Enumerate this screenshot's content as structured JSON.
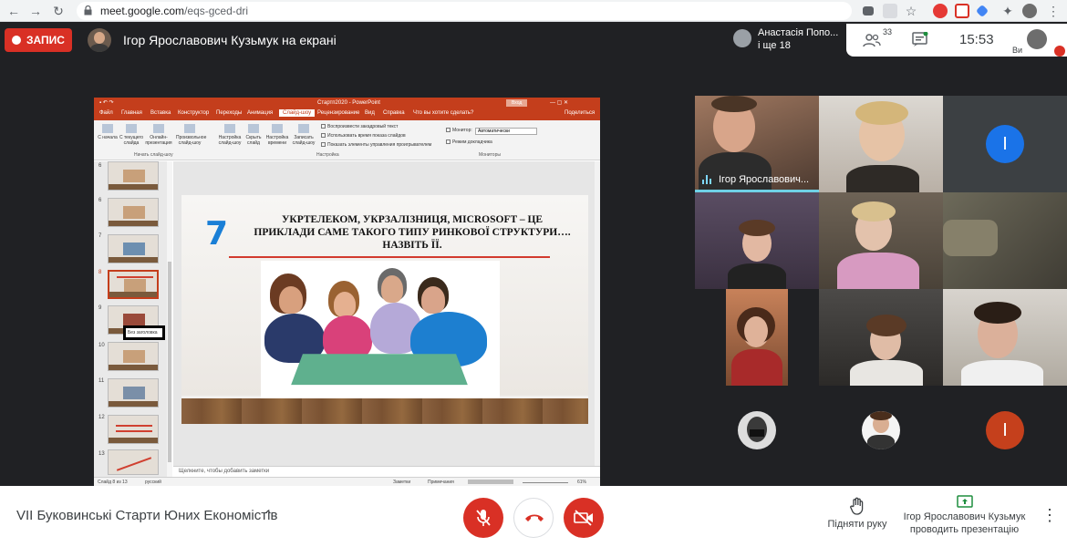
{
  "browser": {
    "url_host": "meet.google.com",
    "url_path": "/eqs-gced-dri"
  },
  "recording": {
    "label": "ЗАПИС"
  },
  "presentation": {
    "title": "Ігор Ярославович Кузьмук на екрані"
  },
  "notification": {
    "line1": "Анастасія Попо...",
    "line2": "і ще 18"
  },
  "status": {
    "participants_count": "33",
    "time": "15:53",
    "me_label": "Ви"
  },
  "ppt": {
    "window_title": "Стартп2020 - PowerPoint",
    "signin": "Вход",
    "tabs": [
      "Файл",
      "Главная",
      "Вставка",
      "Конструктор",
      "Переходы",
      "Анимация",
      "Слайд-шоу",
      "Рецензирование",
      "Вид",
      "Справка",
      "Что вы хотите сделать?",
      "Поделиться"
    ],
    "ribbon": {
      "buttons": [
        "С начала",
        "С текущего слайда",
        "Онлайн-презентация",
        "Произвольное слайд-шоу",
        "Настройка слайд-шоу",
        "Скрыть слайд",
        "Настройка времени",
        "Записать слайд-шоу"
      ],
      "group_start": "Начать слайд-шоу",
      "group_setup": "Настройка",
      "group_monitors": "Мониторы",
      "check1": "Воспроизвести закадровый текст",
      "check2": "Использовать время показа слайдов",
      "check3": "Показать элементы управления проигрывателем",
      "monitor_label": "Монитор:",
      "monitor_value": "Автоматически",
      "presenter_view": "Режим докладчика"
    },
    "thumb_numbers": [
      "6",
      "7",
      "8",
      "9",
      "10",
      "11",
      "12",
      "13"
    ],
    "tooltip": "Без заголовка",
    "slide": {
      "number": "7",
      "headline": "УКРТЕЛЕКОМ, УКРЗАЛІЗНИЦЯ, MICROSOFT – ЦЕ ПРИКЛАДИ САМЕ ТАКОГО ТИПУ РИНКОВОЇ СТРУКТУРИ…. НАЗВІТЬ ЇЇ."
    },
    "notes_placeholder": "Щелкните, чтобы добавить заметки",
    "statusbar": {
      "slide_of": "Слайд 8 из 13",
      "lang": "русский",
      "notes": "Заметки",
      "comments": "Примечания",
      "zoom": "61%"
    }
  },
  "tiles": {
    "speaker_name": "Ігор Ярославович...",
    "letter1": "І",
    "letter2": "І",
    "letter1_color": "#1a73e8",
    "letter2_color": "#c5401c"
  },
  "bottom": {
    "meeting_title": "VII Буковинські Старти Юних Економістів",
    "raise_hand": "Підняти руку",
    "presenting_line1": "Ігор Ярославович Кузьмук",
    "presenting_line2": "проводить презентацію"
  }
}
